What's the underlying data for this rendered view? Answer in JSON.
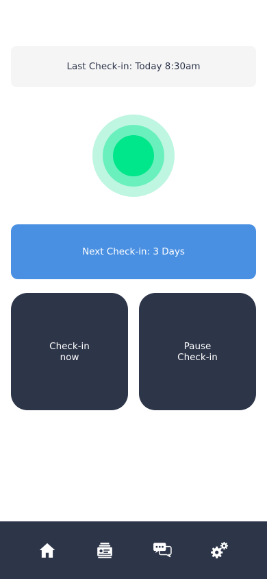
{
  "last_checkin": {
    "text": "Last Check-in: Today 8:30am"
  },
  "status": {
    "indicator": "green"
  },
  "next_checkin": {
    "text": "Next Check-in: 3 Days"
  },
  "actions": {
    "checkin_now": "Check-in\nnow",
    "pause_checkin": "Pause\nCheck-in"
  },
  "nav": {
    "items": [
      {
        "icon": "home-icon"
      },
      {
        "icon": "records-icon"
      },
      {
        "icon": "messages-icon"
      },
      {
        "icon": "settings-icon"
      }
    ]
  },
  "colors": {
    "dark": "#2d3549",
    "accent_blue": "#4a90e2",
    "status_green": "#00e68a",
    "card_bg": "#f5f5f6"
  }
}
